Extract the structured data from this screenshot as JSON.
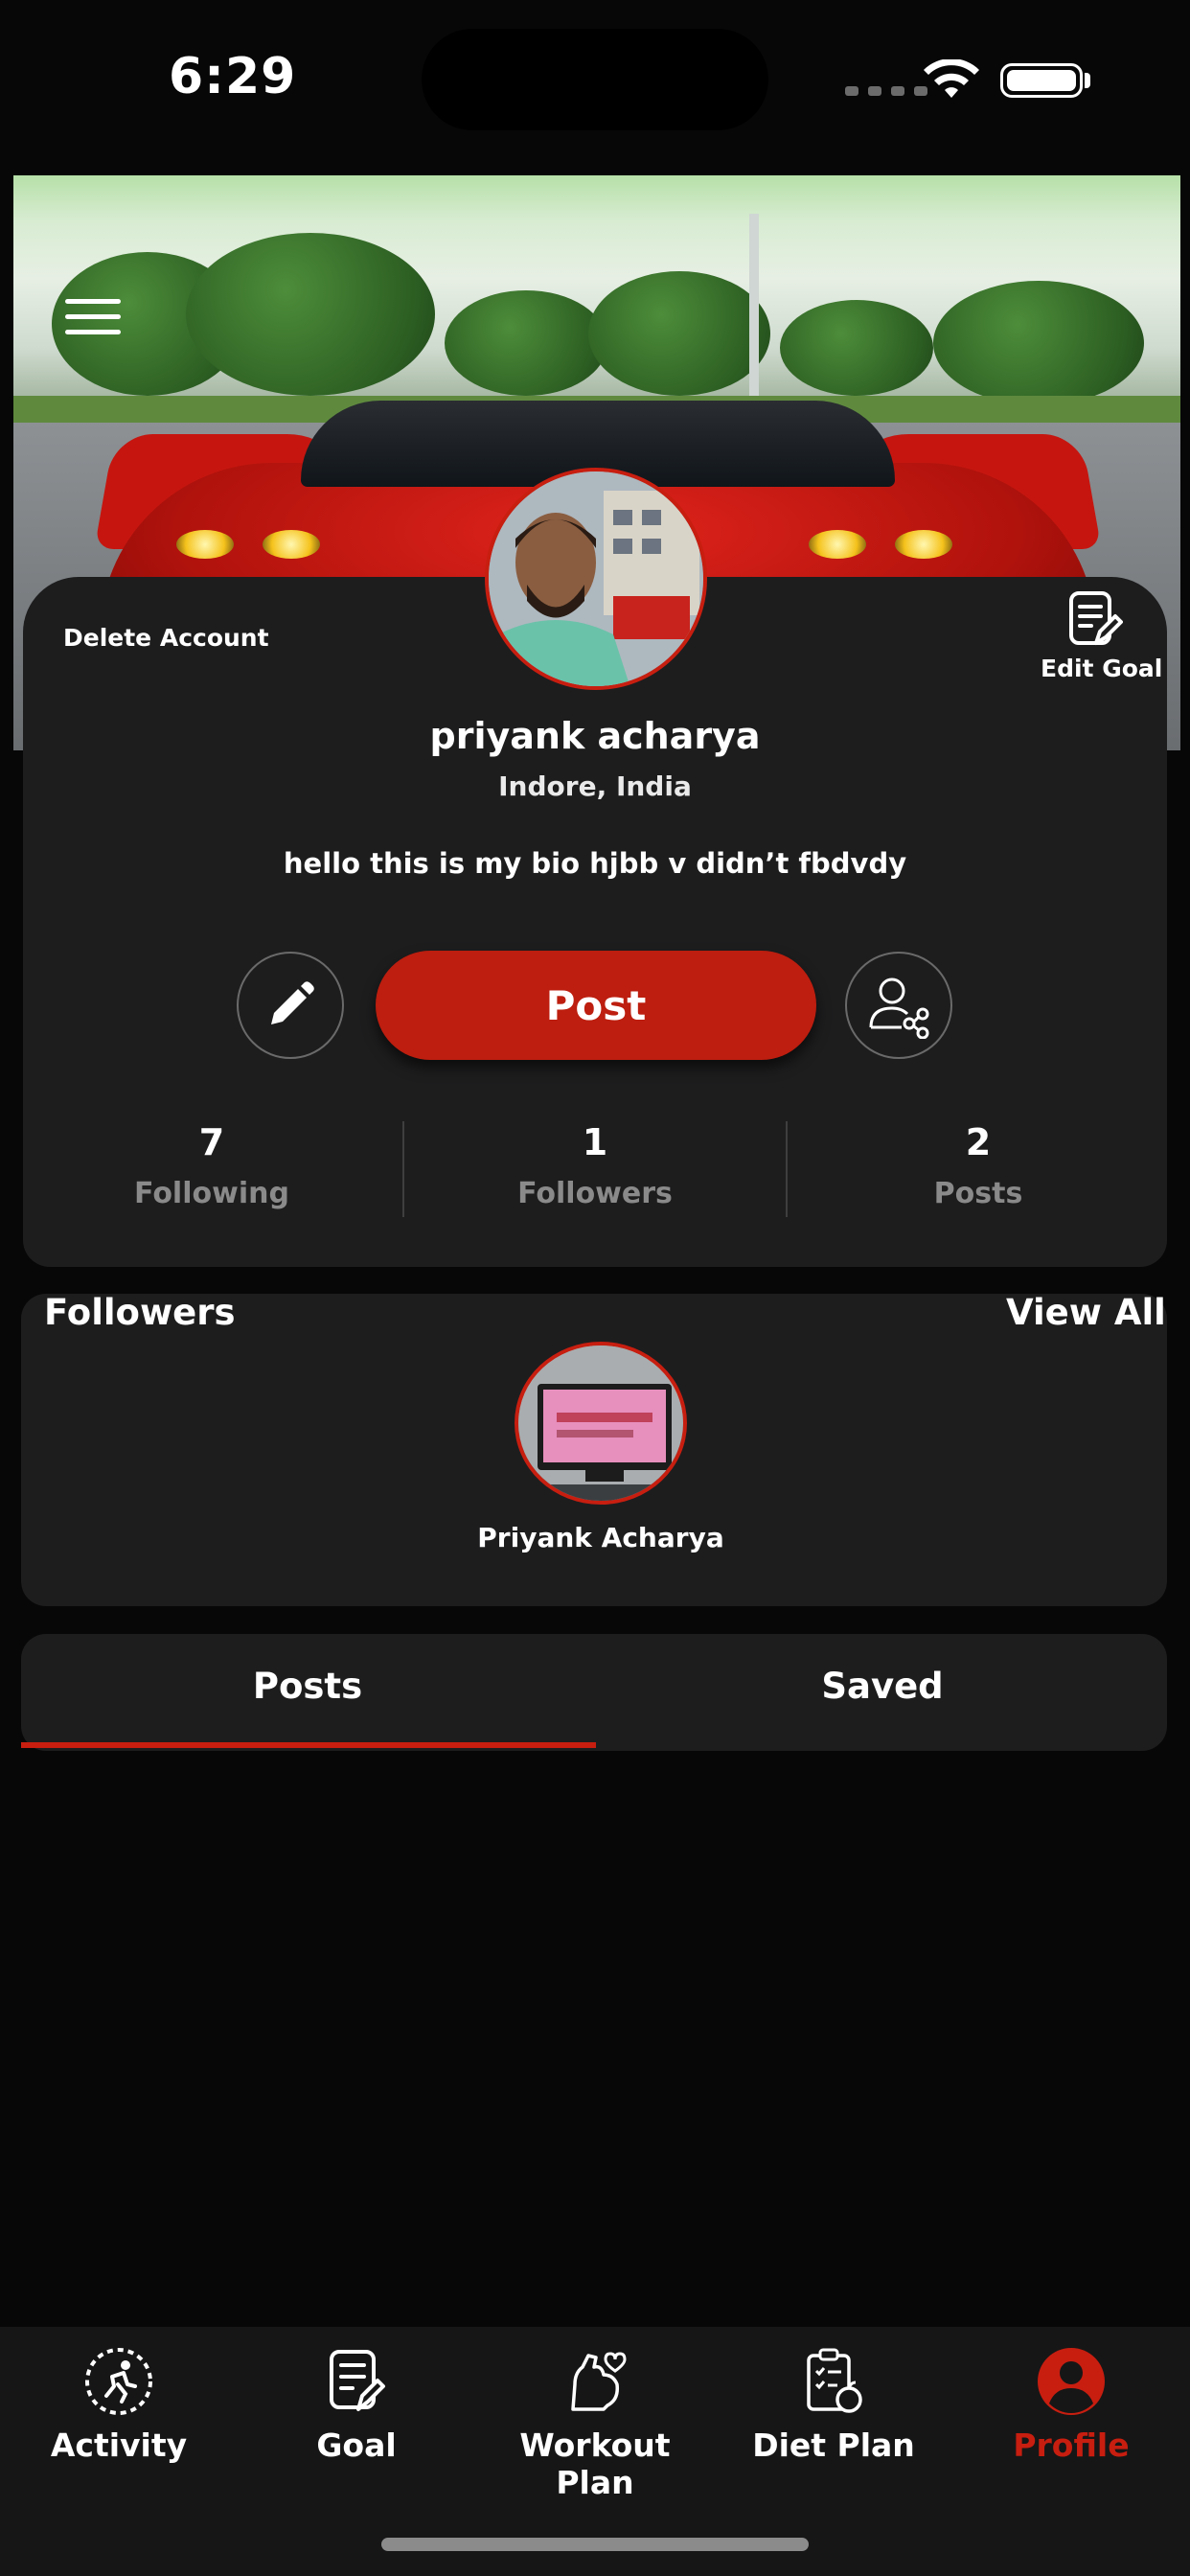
{
  "status_bar": {
    "time": "6:29"
  },
  "profile": {
    "delete_account": "Delete Account",
    "edit_goal": "Edit Goal",
    "name": "priyank acharya",
    "location": "Indore, India",
    "bio": "hello this is my bio hjbb v didn’t fbdvdy",
    "post_button": "Post",
    "stats": [
      {
        "value": "7",
        "label": "Following"
      },
      {
        "value": "1",
        "label": "Followers"
      },
      {
        "value": "2",
        "label": "Posts"
      }
    ]
  },
  "followers": {
    "title": "Followers",
    "view_all": "View All",
    "items": [
      {
        "name": "Priyank Acharya"
      }
    ]
  },
  "tabs": [
    {
      "label": "Posts",
      "active": true
    },
    {
      "label": "Saved",
      "active": false
    }
  ],
  "bottom_nav": [
    {
      "label": "Activity",
      "icon": "activity-icon"
    },
    {
      "label": "Goal",
      "icon": "goal-icon"
    },
    {
      "label": "Workout Plan",
      "icon": "workout-icon"
    },
    {
      "label": "Diet Plan",
      "icon": "diet-icon"
    },
    {
      "label": "Profile",
      "icon": "profile-icon",
      "active": true
    }
  ],
  "colors": {
    "accent": "#c71e10",
    "card": "#1d1d1e",
    "background": "#070707"
  }
}
